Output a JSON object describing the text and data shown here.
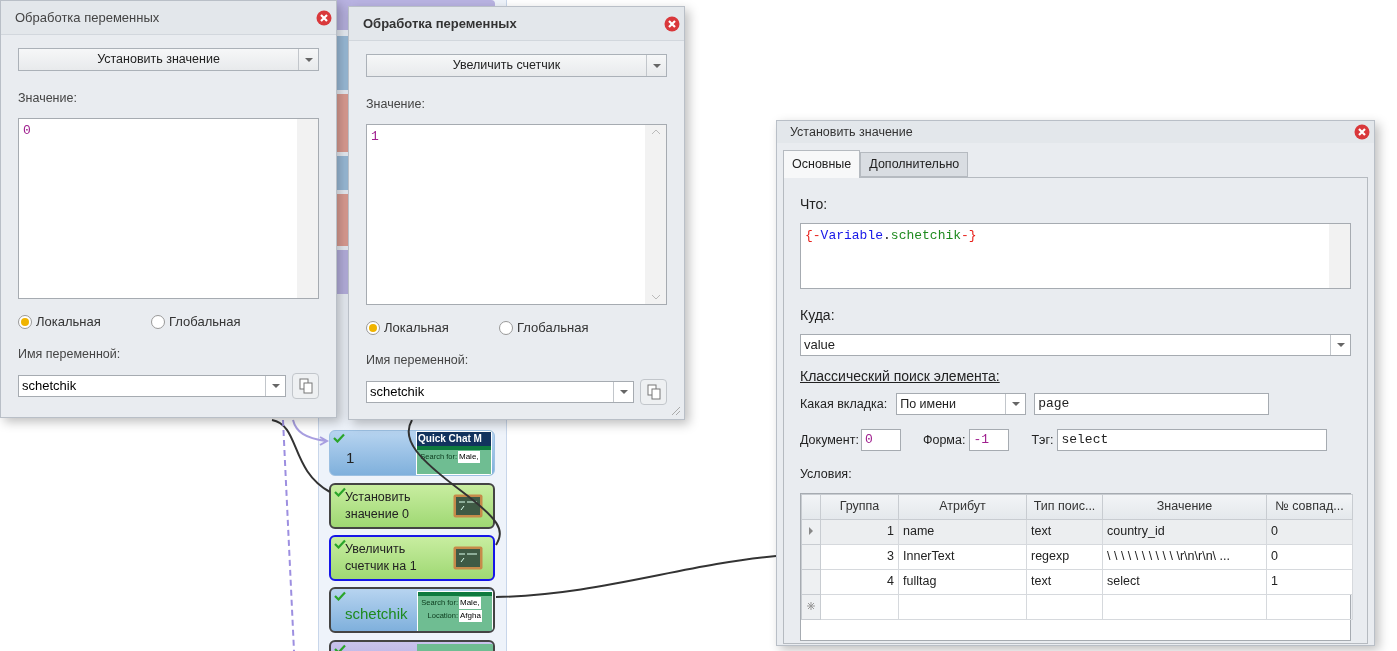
{
  "canvas": {
    "nodes": [
      {
        "kind": "page",
        "text": "1",
        "selected": false,
        "thumb": {
          "title": "Quick Chat M",
          "fields": [
            {
              "label": "Search for:",
              "value": "Male,"
            }
          ]
        }
      },
      {
        "kind": "action",
        "text": "Установить значение 0",
        "selected": false
      },
      {
        "kind": "action",
        "text": "Увеличить счетчик на 1",
        "selected": true
      },
      {
        "kind": "variable",
        "text": "schetchik",
        "selected": false,
        "thumb": {
          "fields": [
            {
              "label": "Search for:",
              "value": "Male,"
            },
            {
              "label": "Location:",
              "value": "Afgha"
            }
          ]
        }
      },
      {
        "kind": "other",
        "selected": false
      }
    ]
  },
  "dialogs": [
    {
      "title": "Обработка переменных",
      "active": false,
      "action": "Установить значение",
      "value_label": "Значение:",
      "value": "0",
      "scope": [
        {
          "label": "Локальная",
          "selected": true
        },
        {
          "label": "Глобальная",
          "selected": false
        }
      ],
      "name_label": "Имя переменной:",
      "variable_name": "schetchik"
    },
    {
      "title": "Обработка переменных",
      "active": true,
      "action": "Увеличить счетчик",
      "value_label": "Значение:",
      "value": "1",
      "scope": [
        {
          "label": "Локальная",
          "selected": true
        },
        {
          "label": "Глобальная",
          "selected": false
        }
      ],
      "name_label": "Имя переменной:",
      "variable_name": "schetchik"
    }
  ],
  "set_value_dialog": {
    "title": "Установить значение",
    "tabs": [
      {
        "label": "Основные",
        "selected": true
      },
      {
        "label": "Дополнительно",
        "selected": false
      }
    ],
    "what_label": "Что:",
    "what_code": [
      {
        "kind": "brace",
        "text": "{-"
      },
      {
        "kind": "keyword",
        "text": "Variable"
      },
      {
        "kind": "dot",
        "text": "."
      },
      {
        "kind": "name",
        "text": "schetchik"
      },
      {
        "kind": "brace",
        "text": "-}"
      }
    ],
    "where_label": "Куда:",
    "where": "value",
    "search_heading": "Классический поиск элемента:",
    "tab_label": "Какая вкладка:",
    "tab_mode": "По имени",
    "tab_value": "page",
    "document_label": "Документ:",
    "document": "0",
    "form_label": "Форма:",
    "form": "-1",
    "tag_label": "Тэг:",
    "tag": "select",
    "conditions_label": "Условия:",
    "table": {
      "columns": [
        "Группа",
        "Атрибут",
        "Тип поис...",
        "Значение",
        "№ совпад..."
      ],
      "rows": [
        {
          "selected": true,
          "cells": [
            "1",
            "name",
            "text",
            "country_id",
            "0"
          ]
        },
        {
          "selected": false,
          "cells": [
            "3",
            "InnerText",
            "regexp",
            "\\ \\ \\ \\ \\ \\ \\ \\ \\ \\ \\r\\n\\r\\n\\ ...",
            "0"
          ]
        },
        {
          "selected": false,
          "cells": [
            "4",
            "fulltag",
            "text",
            "select",
            "1"
          ]
        }
      ]
    }
  }
}
